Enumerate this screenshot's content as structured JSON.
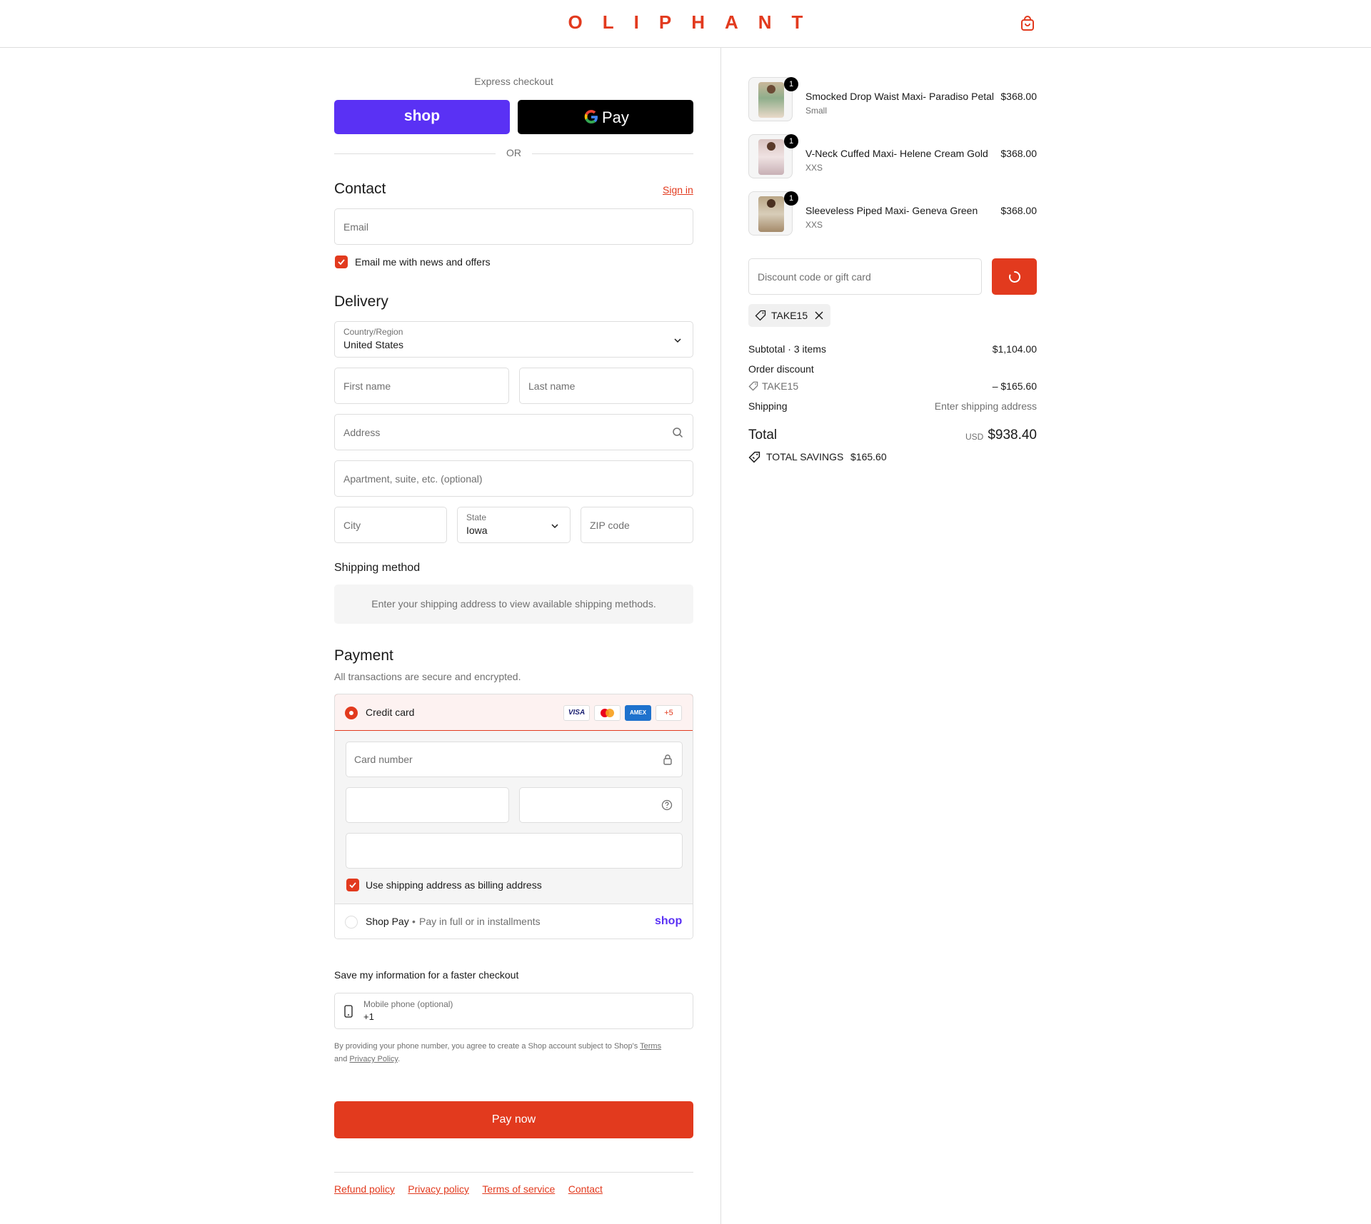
{
  "brand": {
    "name": "OLIPHANT",
    "accent": "#e23a1e"
  },
  "express": {
    "label": "Express checkout",
    "shop_label": "shop",
    "gpay_label": "Pay",
    "or": "OR"
  },
  "contact": {
    "title": "Contact",
    "signin": "Sign in",
    "email_placeholder": "Email",
    "news_label": "Email me with news and offers"
  },
  "delivery": {
    "title": "Delivery",
    "country_label": "Country/Region",
    "country_value": "United States",
    "first_name": "First name",
    "last_name": "Last name",
    "address": "Address",
    "apartment": "Apartment, suite, etc. (optional)",
    "city": "City",
    "state_label": "State",
    "state_value": "Iowa",
    "zip": "ZIP code"
  },
  "shipping": {
    "title": "Shipping method",
    "message": "Enter your shipping address to view available shipping methods."
  },
  "payment": {
    "title": "Payment",
    "subtitle": "All transactions are secure and encrypted.",
    "credit_card": "Credit card",
    "more_cards": "+5",
    "card_number": "Card number",
    "billing_same": "Use shipping address as billing address",
    "shop_pay": "Shop Pay",
    "shop_pay_sub": "Pay in full or in installments",
    "shop_logo": "shop"
  },
  "save_info": {
    "title": "Save my information for a faster checkout",
    "phone_label": "Mobile phone (optional)",
    "phone_value": "+1",
    "legal_prefix": "By providing your phone number, you agree to create a Shop account subject to Shop's",
    "terms": "Terms",
    "and": "and",
    "privacy": "Privacy Policy"
  },
  "pay_now": "Pay now",
  "footer_links": [
    "Refund policy",
    "Privacy policy",
    "Terms of service",
    "Contact"
  ],
  "cart": {
    "items": [
      {
        "name": "Smocked Drop Waist Maxi- Paradiso Petal",
        "variant": "Small",
        "price": "$368.00",
        "qty": "1"
      },
      {
        "name": "V-Neck Cuffed Maxi- Helene Cream Gold",
        "variant": "XXS",
        "price": "$368.00",
        "qty": "1"
      },
      {
        "name": "Sleeveless Piped Maxi- Geneva Green",
        "variant": "XXS",
        "price": "$368.00",
        "qty": "1"
      }
    ],
    "discount_placeholder": "Discount code or gift card",
    "applied_code": "TAKE15",
    "subtotal_label": "Subtotal · 3 items",
    "subtotal_value": "$1,104.00",
    "order_discount_label": "Order discount",
    "discount_code": "TAKE15",
    "discount_value": "– $165.60",
    "shipping_label": "Shipping",
    "shipping_value": "Enter shipping address",
    "total_label": "Total",
    "currency": "USD",
    "total_value": "$938.40",
    "savings_label": "TOTAL SAVINGS",
    "savings_value": "$165.60"
  }
}
